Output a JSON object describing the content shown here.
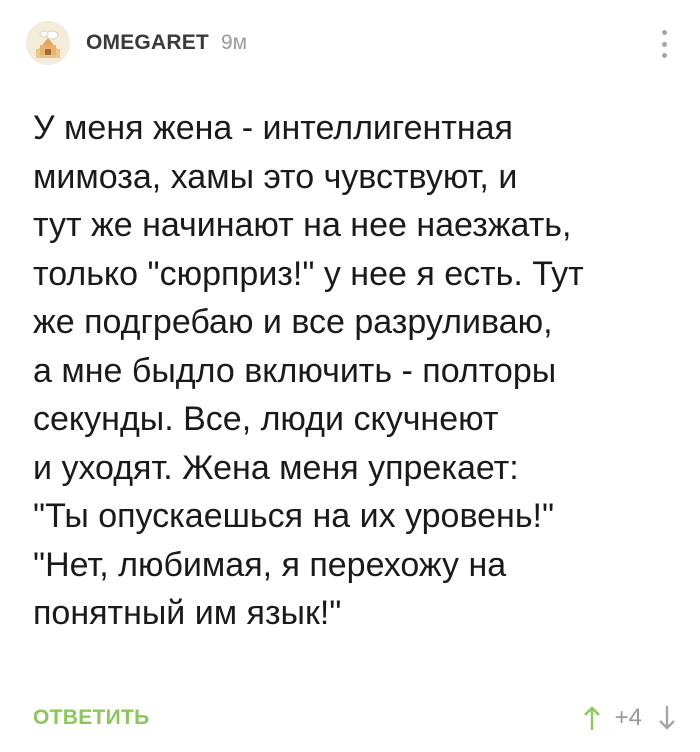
{
  "header": {
    "username": "OMEGARET",
    "time": "9м"
  },
  "comment": {
    "lines": [
      "У меня жена - интеллигентная",
      "мимоза, хамы это чувствуют, и",
      "тут же начинают на нее наезжать,",
      "только \"сюрприз!\" у нее я есть. Тут",
      "же подгребаю и все разруливаю,",
      "а мне быдло включить - полторы",
      "секунды. Все, люди скучнеют",
      "и уходят. Жена меня упрекает:",
      "\"Ты опускаешься на их уровень!\"",
      "\"Нет, любимая, я перехожу на",
      "понятный им язык!\""
    ]
  },
  "footer": {
    "reply_label": "ОТВЕТИТЬ",
    "rating": "+4"
  },
  "colors": {
    "accent": "#8ac858",
    "muted": "#9a9a9a",
    "text": "#1a1a1a"
  },
  "icons": {
    "avatar": "house-avatar-icon",
    "menu": "more-vertical-icon",
    "upvote": "arrow-up-icon",
    "downvote": "arrow-down-icon"
  }
}
